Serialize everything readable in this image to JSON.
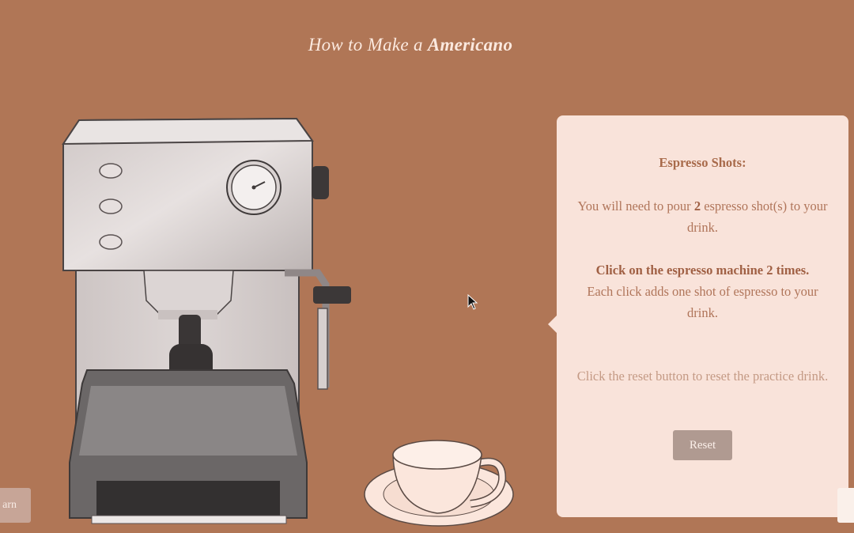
{
  "header": {
    "title_prefix": "How to Make a ",
    "title_drink": "Americano"
  },
  "panel": {
    "heading": "Espresso Shots:",
    "instruction_pre": "You will need to pour ",
    "shot_count": "2",
    "instruction_post": " espresso shot(s) to your drink.",
    "click_instruction": "Click on the espresso machine 2 times.",
    "click_detail": "Each click adds one shot of espresso to your drink.",
    "reset_hint": "Click the reset button to reset the practice drink.",
    "reset_label": "Reset"
  },
  "footer": {
    "learn_label": "arn"
  },
  "colors": {
    "background": "#b07656",
    "panel": "#f9e3da",
    "panel_text": "#b0755a",
    "reset_button": "#b09a91"
  }
}
